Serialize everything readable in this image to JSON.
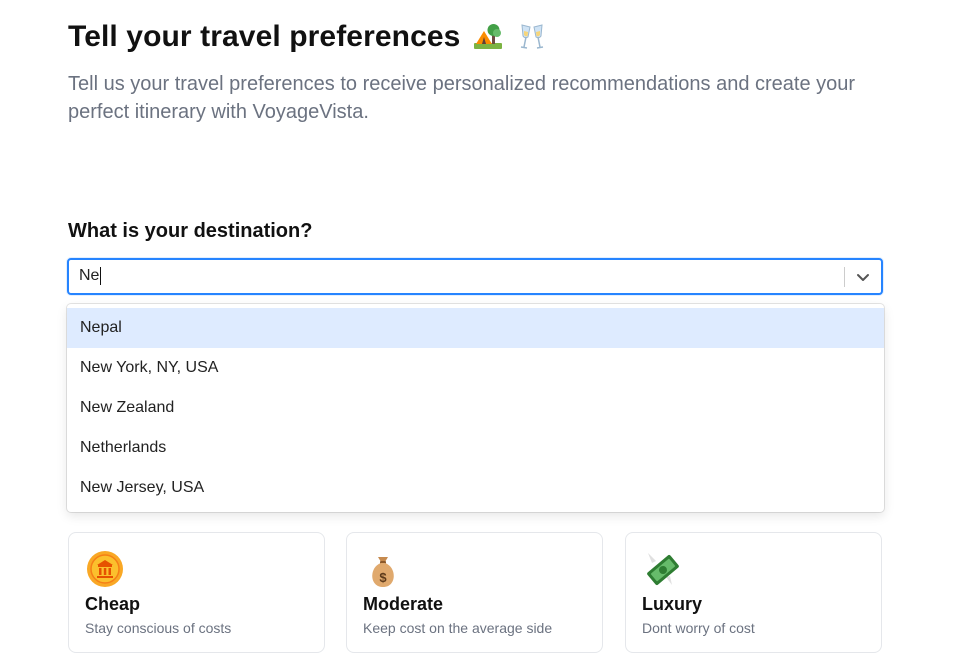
{
  "header": {
    "title": "Tell your travel preferences",
    "subtitle": "Tell us your travel preferences to receive personalized recommendations and create your perfect itinerary with VoyageVista."
  },
  "destination": {
    "question": "What is your destination?",
    "input_value": "Ne",
    "options": [
      "Nepal",
      "New York, NY, USA",
      "New Zealand",
      "Netherlands",
      "New Jersey, USA"
    ],
    "highlighted": "Nepal"
  },
  "budget": {
    "options": [
      {
        "name": "Cheap",
        "desc": "Stay conscious of costs",
        "icon": "coin-icon"
      },
      {
        "name": "Moderate",
        "desc": "Keep cost on the average side",
        "icon": "money-bag-icon"
      },
      {
        "name": "Luxury",
        "desc": "Dont worry of cost",
        "icon": "flying-money-icon"
      }
    ]
  },
  "colors": {
    "focus_border": "#2684ff",
    "highlight": "#deebff",
    "muted_text": "#6b7280"
  }
}
